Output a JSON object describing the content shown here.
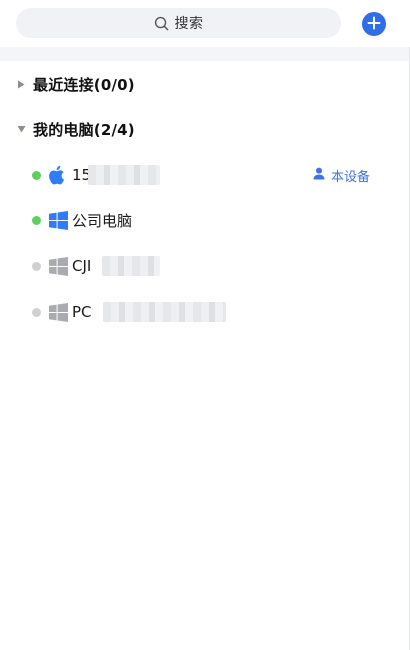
{
  "search": {
    "placeholder": "搜索",
    "icon": "search-icon"
  },
  "toolbar": {
    "add_icon": "plus-circle-icon",
    "accent_color": "#2f6ee8"
  },
  "groups": [
    {
      "title": "最近连接(0/0)",
      "expanded": false
    },
    {
      "title": "我的电脑(2/4)",
      "expanded": true,
      "devices": [
        {
          "name": "15",
          "os": "apple-icon",
          "online": true,
          "status_color": "#5ccf5c",
          "badge": "本设备",
          "badge_icon": "user-icon"
        },
        {
          "name": "公司电脑",
          "os": "windows-icon",
          "online": true,
          "status_color": "#5ccf5c"
        },
        {
          "name": "CJI",
          "os": "windows-icon",
          "online": false,
          "status_color": "#d0d0d0"
        },
        {
          "name": "PC",
          "os": "windows-icon",
          "online": false,
          "status_color": "#d0d0d0"
        }
      ]
    }
  ]
}
